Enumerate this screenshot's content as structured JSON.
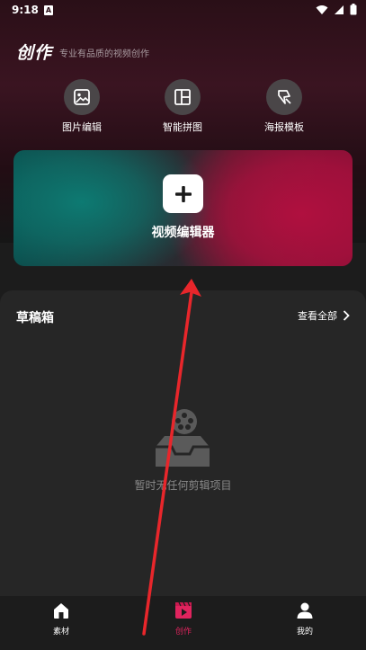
{
  "status": {
    "time": "9:18",
    "notification_glyph": "A"
  },
  "header": {
    "title": "创作",
    "subtitle": "专业有品质的视频创作"
  },
  "tools": [
    {
      "label": "图片编辑",
      "icon": "image-icon"
    },
    {
      "label": "智能拼图",
      "icon": "collage-icon"
    },
    {
      "label": "海报模板",
      "icon": "poster-template-icon"
    }
  ],
  "video_card": {
    "label": "视频编辑器"
  },
  "drafts": {
    "title": "草稿箱",
    "view_all": "查看全部",
    "empty_text": "暂时无任何剪辑项目"
  },
  "nav": [
    {
      "label": "素材",
      "icon": "home-icon",
      "active": false
    },
    {
      "label": "创作",
      "icon": "play-clapper-icon",
      "active": true
    },
    {
      "label": "我的",
      "icon": "person-icon",
      "active": false
    }
  ],
  "colors": {
    "accent": "#e0245e",
    "panel": "#262626",
    "teal": "#0d7a72",
    "magenta": "#b0103f",
    "annotation_arrow": "#e8262b"
  }
}
